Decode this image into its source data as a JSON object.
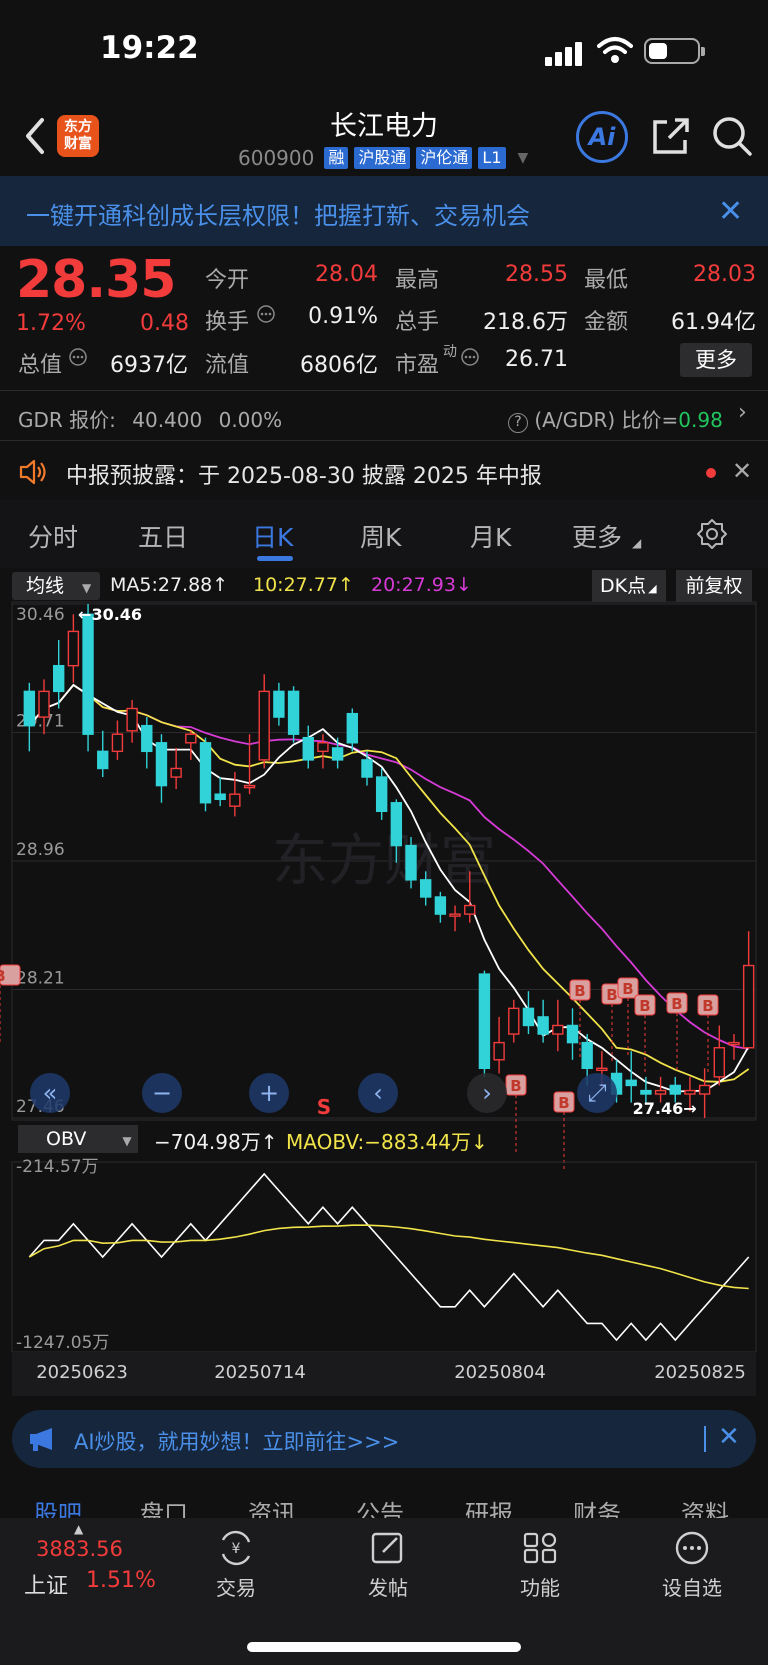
{
  "status": {
    "time": "19:22"
  },
  "header": {
    "logo_line1": "东方",
    "logo_line2": "财富",
    "stock_name": "长江电力",
    "stock_code": "600900",
    "tags": [
      "融",
      "沪股通",
      "沪伦通",
      "L1"
    ],
    "ai_label": "Ai"
  },
  "promo": {
    "text": "一键开通科创成长层权限！把握打新、交易机会",
    "close": "✕"
  },
  "quote": {
    "price": "28.35",
    "change_pct": "1.72%",
    "change_abs": "0.48",
    "open_label": "今开",
    "open": "28.04",
    "high_label": "最高",
    "high": "28.55",
    "low_label": "最低",
    "low": "28.03",
    "turnover_label": "换手",
    "turnover": "0.91%",
    "volume_label": "总手",
    "volume": "218.6万",
    "amount_label": "金额",
    "amount": "61.94亿",
    "mktcap_label": "总值",
    "mktcap": "6937亿",
    "float_label": "流值",
    "float": "6806亿",
    "pe_label": "市盈",
    "pe_sup": "动",
    "pe": "26.71",
    "more": "更多"
  },
  "gdr": {
    "label": "GDR 报价:",
    "price": "40.400",
    "pct": "0.00%",
    "ratio_label": "(A/GDR) 比价=",
    "ratio": "0.98"
  },
  "notice": {
    "text": "中报预披露：于 2025-08-30 披露 2025 年中报"
  },
  "period_tabs": [
    "分时",
    "五日",
    "日K",
    "周K",
    "月K",
    "更多"
  ],
  "chart_controls": {
    "ma_select": "均线",
    "ma5": "MA5:27.88↑",
    "ma10": "10:27.77↑",
    "ma20": "20:27.93↓",
    "dk": "DK点",
    "adjust": "前复权",
    "obv_select": "OBV",
    "obv": "−704.98万↑",
    "maobv": "MAOBV:−883.44万↓"
  },
  "chart_data": [
    {
      "type": "candlestick",
      "title": "",
      "ylim": [
        27.46,
        30.46
      ],
      "y_ticks": [
        "30.46",
        "29.71",
        "28.96",
        "28.21",
        "27.46"
      ],
      "x_ticks": [
        "20250623",
        "20250714",
        "20250804",
        "20250825"
      ],
      "annotations": [
        "←30.46",
        "27.46→"
      ],
      "markers": [
        "S",
        "B"
      ],
      "candles": [
        [
          29.95,
          29.75,
          30.0,
          29.6
        ],
        [
          29.8,
          29.95,
          30.02,
          29.7
        ],
        [
          30.1,
          29.95,
          30.25,
          29.85
        ],
        [
          30.1,
          30.3,
          30.4,
          30.0
        ],
        [
          30.4,
          29.7,
          30.46,
          29.6
        ],
        [
          29.6,
          29.5,
          29.72,
          29.45
        ],
        [
          29.6,
          29.7,
          29.78,
          29.55
        ],
        [
          29.72,
          29.85,
          29.9,
          29.65
        ],
        [
          29.75,
          29.6,
          29.8,
          29.5
        ],
        [
          29.65,
          29.4,
          29.7,
          29.3
        ],
        [
          29.45,
          29.5,
          29.62,
          29.38
        ],
        [
          29.65,
          29.7,
          29.72,
          29.55
        ],
        [
          29.65,
          29.3,
          29.68,
          29.25
        ],
        [
          29.35,
          29.32,
          29.45,
          29.28
        ],
        [
          29.28,
          29.35,
          29.48,
          29.22
        ],
        [
          29.4,
          29.4,
          29.7,
          29.35
        ],
        [
          29.55,
          29.95,
          30.05,
          29.5
        ],
        [
          29.95,
          29.8,
          30.0,
          29.75
        ],
        [
          29.95,
          29.7,
          29.98,
          29.65
        ],
        [
          29.68,
          29.55,
          29.75,
          29.5
        ],
        [
          29.6,
          29.65,
          29.7,
          29.5
        ],
        [
          29.62,
          29.55,
          29.68,
          29.5
        ],
        [
          29.82,
          29.65,
          29.85,
          29.6
        ],
        [
          29.55,
          29.45,
          29.6,
          29.4
        ],
        [
          29.45,
          29.25,
          29.5,
          29.2
        ],
        [
          29.3,
          29.05,
          29.32,
          28.95
        ],
        [
          29.05,
          28.85,
          29.1,
          28.8
        ],
        [
          28.85,
          28.75,
          28.9,
          28.7
        ],
        [
          28.75,
          28.65,
          28.78,
          28.6
        ],
        [
          28.65,
          28.65,
          28.7,
          28.55
        ],
        [
          28.65,
          28.7,
          28.9,
          28.6
        ],
        [
          28.3,
          27.75,
          28.32,
          27.7
        ],
        [
          27.8,
          27.9,
          28.05,
          27.72
        ],
        [
          27.95,
          28.1,
          28.15,
          27.9
        ],
        [
          28.1,
          28.0,
          28.2,
          27.95
        ],
        [
          28.05,
          27.95,
          28.15,
          27.9
        ],
        [
          27.95,
          28.0,
          28.15,
          27.85
        ],
        [
          28.0,
          27.9,
          28.1,
          27.8
        ],
        [
          27.9,
          27.75,
          27.95,
          27.65
        ],
        [
          27.75,
          27.75,
          27.85,
          27.62
        ],
        [
          27.72,
          27.6,
          27.8,
          27.55
        ],
        [
          27.68,
          27.65,
          27.85,
          27.55
        ],
        [
          27.62,
          27.6,
          27.7,
          27.55
        ],
        [
          27.6,
          27.62,
          27.7,
          27.55
        ],
        [
          27.65,
          27.6,
          27.7,
          27.55
        ],
        [
          27.6,
          27.62,
          27.7,
          27.5
        ],
        [
          27.6,
          27.65,
          27.75,
          27.46
        ],
        [
          27.7,
          27.87,
          28.0,
          27.65
        ],
        [
          27.9,
          27.9,
          27.95,
          27.8
        ],
        [
          27.87,
          28.35,
          28.55,
          28.03
        ]
      ]
    },
    {
      "type": "line",
      "title": "OBV",
      "ylim": [
        -1247.05,
        -214.57
      ],
      "y_ticks": [
        "-214.57万",
        "-1247.05万"
      ],
      "series": [
        {
          "name": "OBV"
        },
        {
          "name": "MAOBV"
        }
      ]
    }
  ],
  "ai_banner": {
    "text": "AI炒股，就用妙想！立即前往>>>"
  },
  "bottom_tabs": [
    "股吧",
    "盘口",
    "资讯",
    "公告",
    "研报",
    "财务",
    "资料"
  ],
  "bottom_bar": {
    "index_value": "3883.56",
    "index_name": "上证",
    "index_pct": "1.51%",
    "nav": [
      "交易",
      "发帖",
      "功能",
      "设自选"
    ]
  },
  "colors": {
    "up": "#f23b3b",
    "down": "#31d3d8",
    "accent": "#3b78e0",
    "ma5": "#ffffff",
    "ma10": "#f1e34a",
    "ma20": "#d63bd6"
  }
}
